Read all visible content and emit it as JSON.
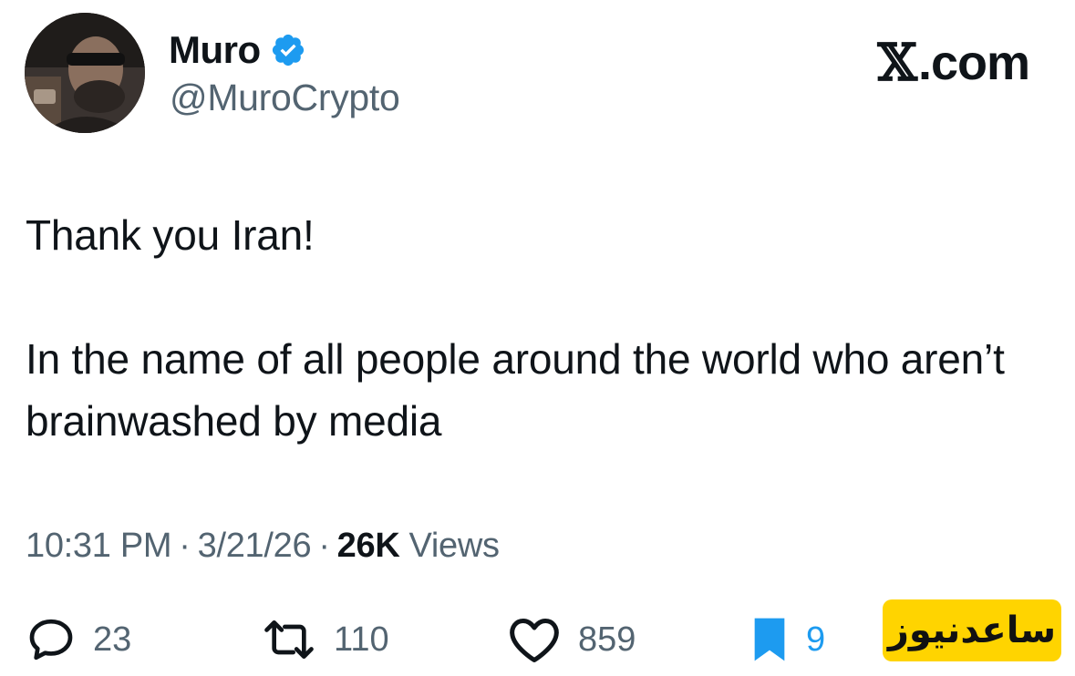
{
  "author": {
    "display_name": "Muro",
    "handle": "@MuroCrypto",
    "verified_icon": "verified-badge-icon",
    "avatar_icon": "profile-photo"
  },
  "brand": {
    "label": ".com",
    "x_glyph": "𝕏"
  },
  "tweet": {
    "paragraphs": [
      "Thank you Iran!",
      "In the name of all people around the world who aren’t brainwashed by media"
    ]
  },
  "meta": {
    "time": "10:31 PM",
    "separator": "·",
    "date": "3/21/26",
    "views_count": "26K",
    "views_label": "Views"
  },
  "actions": {
    "replies": "23",
    "reposts": "110",
    "likes": "859",
    "bookmarks": "9"
  },
  "watermark": {
    "text": "ساعدنیوز"
  },
  "colors": {
    "verified": "#1d9bf0",
    "bookmark": "#1d9bf0",
    "secondary_text": "#536471",
    "primary_text": "#0f1419",
    "watermark_bg": "#ffd400"
  }
}
